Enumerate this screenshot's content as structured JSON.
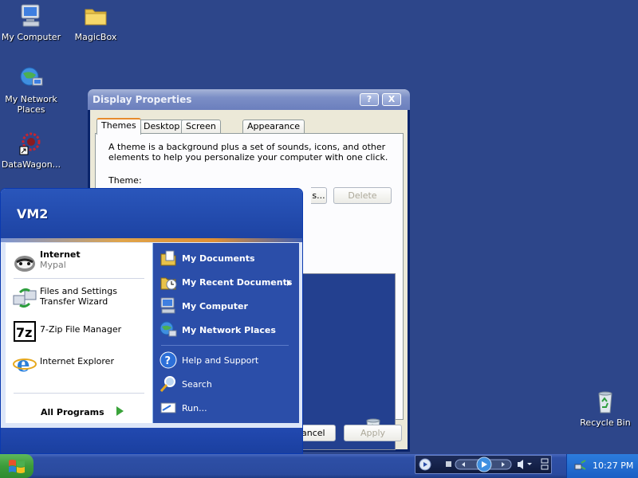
{
  "desktop": {
    "icons": [
      {
        "label": "My Computer",
        "icon": "my-computer-icon"
      },
      {
        "label": "MagicBox",
        "icon": "folder-icon"
      },
      {
        "label": "My Network Places",
        "icon": "network-places-icon"
      },
      {
        "label": "DataWagon...",
        "icon": "shortcut-icon"
      },
      {
        "label": "Recycle Bin",
        "icon": "recycle-bin-icon"
      }
    ]
  },
  "window": {
    "title": "Display Properties",
    "help_label": "?",
    "close_label": "X",
    "tabs": [
      {
        "label": "Themes",
        "active": true
      },
      {
        "label": "Desktop",
        "active": false
      },
      {
        "label": "Screen Saver",
        "active": false
      },
      {
        "label": "Appearance",
        "active": false
      }
    ],
    "description": "A theme is a background plus a set of sounds, icons, and other elements to help you personalize your computer with one click.",
    "theme_label": "Theme:",
    "save_as_partial": "s...",
    "delete_label": "Delete",
    "cancel_partial": "ancel",
    "apply_label": "Apply"
  },
  "start_menu": {
    "user_name": "VM2",
    "pinned": [
      {
        "title": "Internet",
        "subtitle": "Mypal",
        "icon": "mypal-browser-icon"
      }
    ],
    "recent": [
      {
        "label": "Files and Settings Transfer Wizard",
        "icon": "transfer-wizard-icon"
      },
      {
        "label": "7-Zip File Manager",
        "icon": "7zip-icon"
      },
      {
        "label": "Internet Explorer",
        "icon": "internet-explorer-icon"
      }
    ],
    "all_programs_label": "All Programs",
    "places": [
      {
        "label": "My Documents",
        "icon": "my-documents-icon",
        "bold": true
      },
      {
        "label": "My Recent Documents",
        "icon": "recent-documents-icon",
        "bold": true,
        "submenu": true
      },
      {
        "label": "My Computer",
        "icon": "my-computer-icon",
        "bold": true
      },
      {
        "label": "My Network Places",
        "icon": "network-places-icon",
        "bold": true
      }
    ],
    "system": [
      {
        "label": "Help and Support",
        "icon": "help-icon"
      },
      {
        "label": "Search",
        "icon": "search-icon"
      },
      {
        "label": "Run...",
        "icon": "run-icon"
      }
    ]
  },
  "taskbar": {
    "clock": "10:27 PM"
  },
  "colors": {
    "desktop": "#2d468a",
    "start_menu_blue": "#2b4ea9",
    "start_button_green": "#3c9c3a"
  }
}
